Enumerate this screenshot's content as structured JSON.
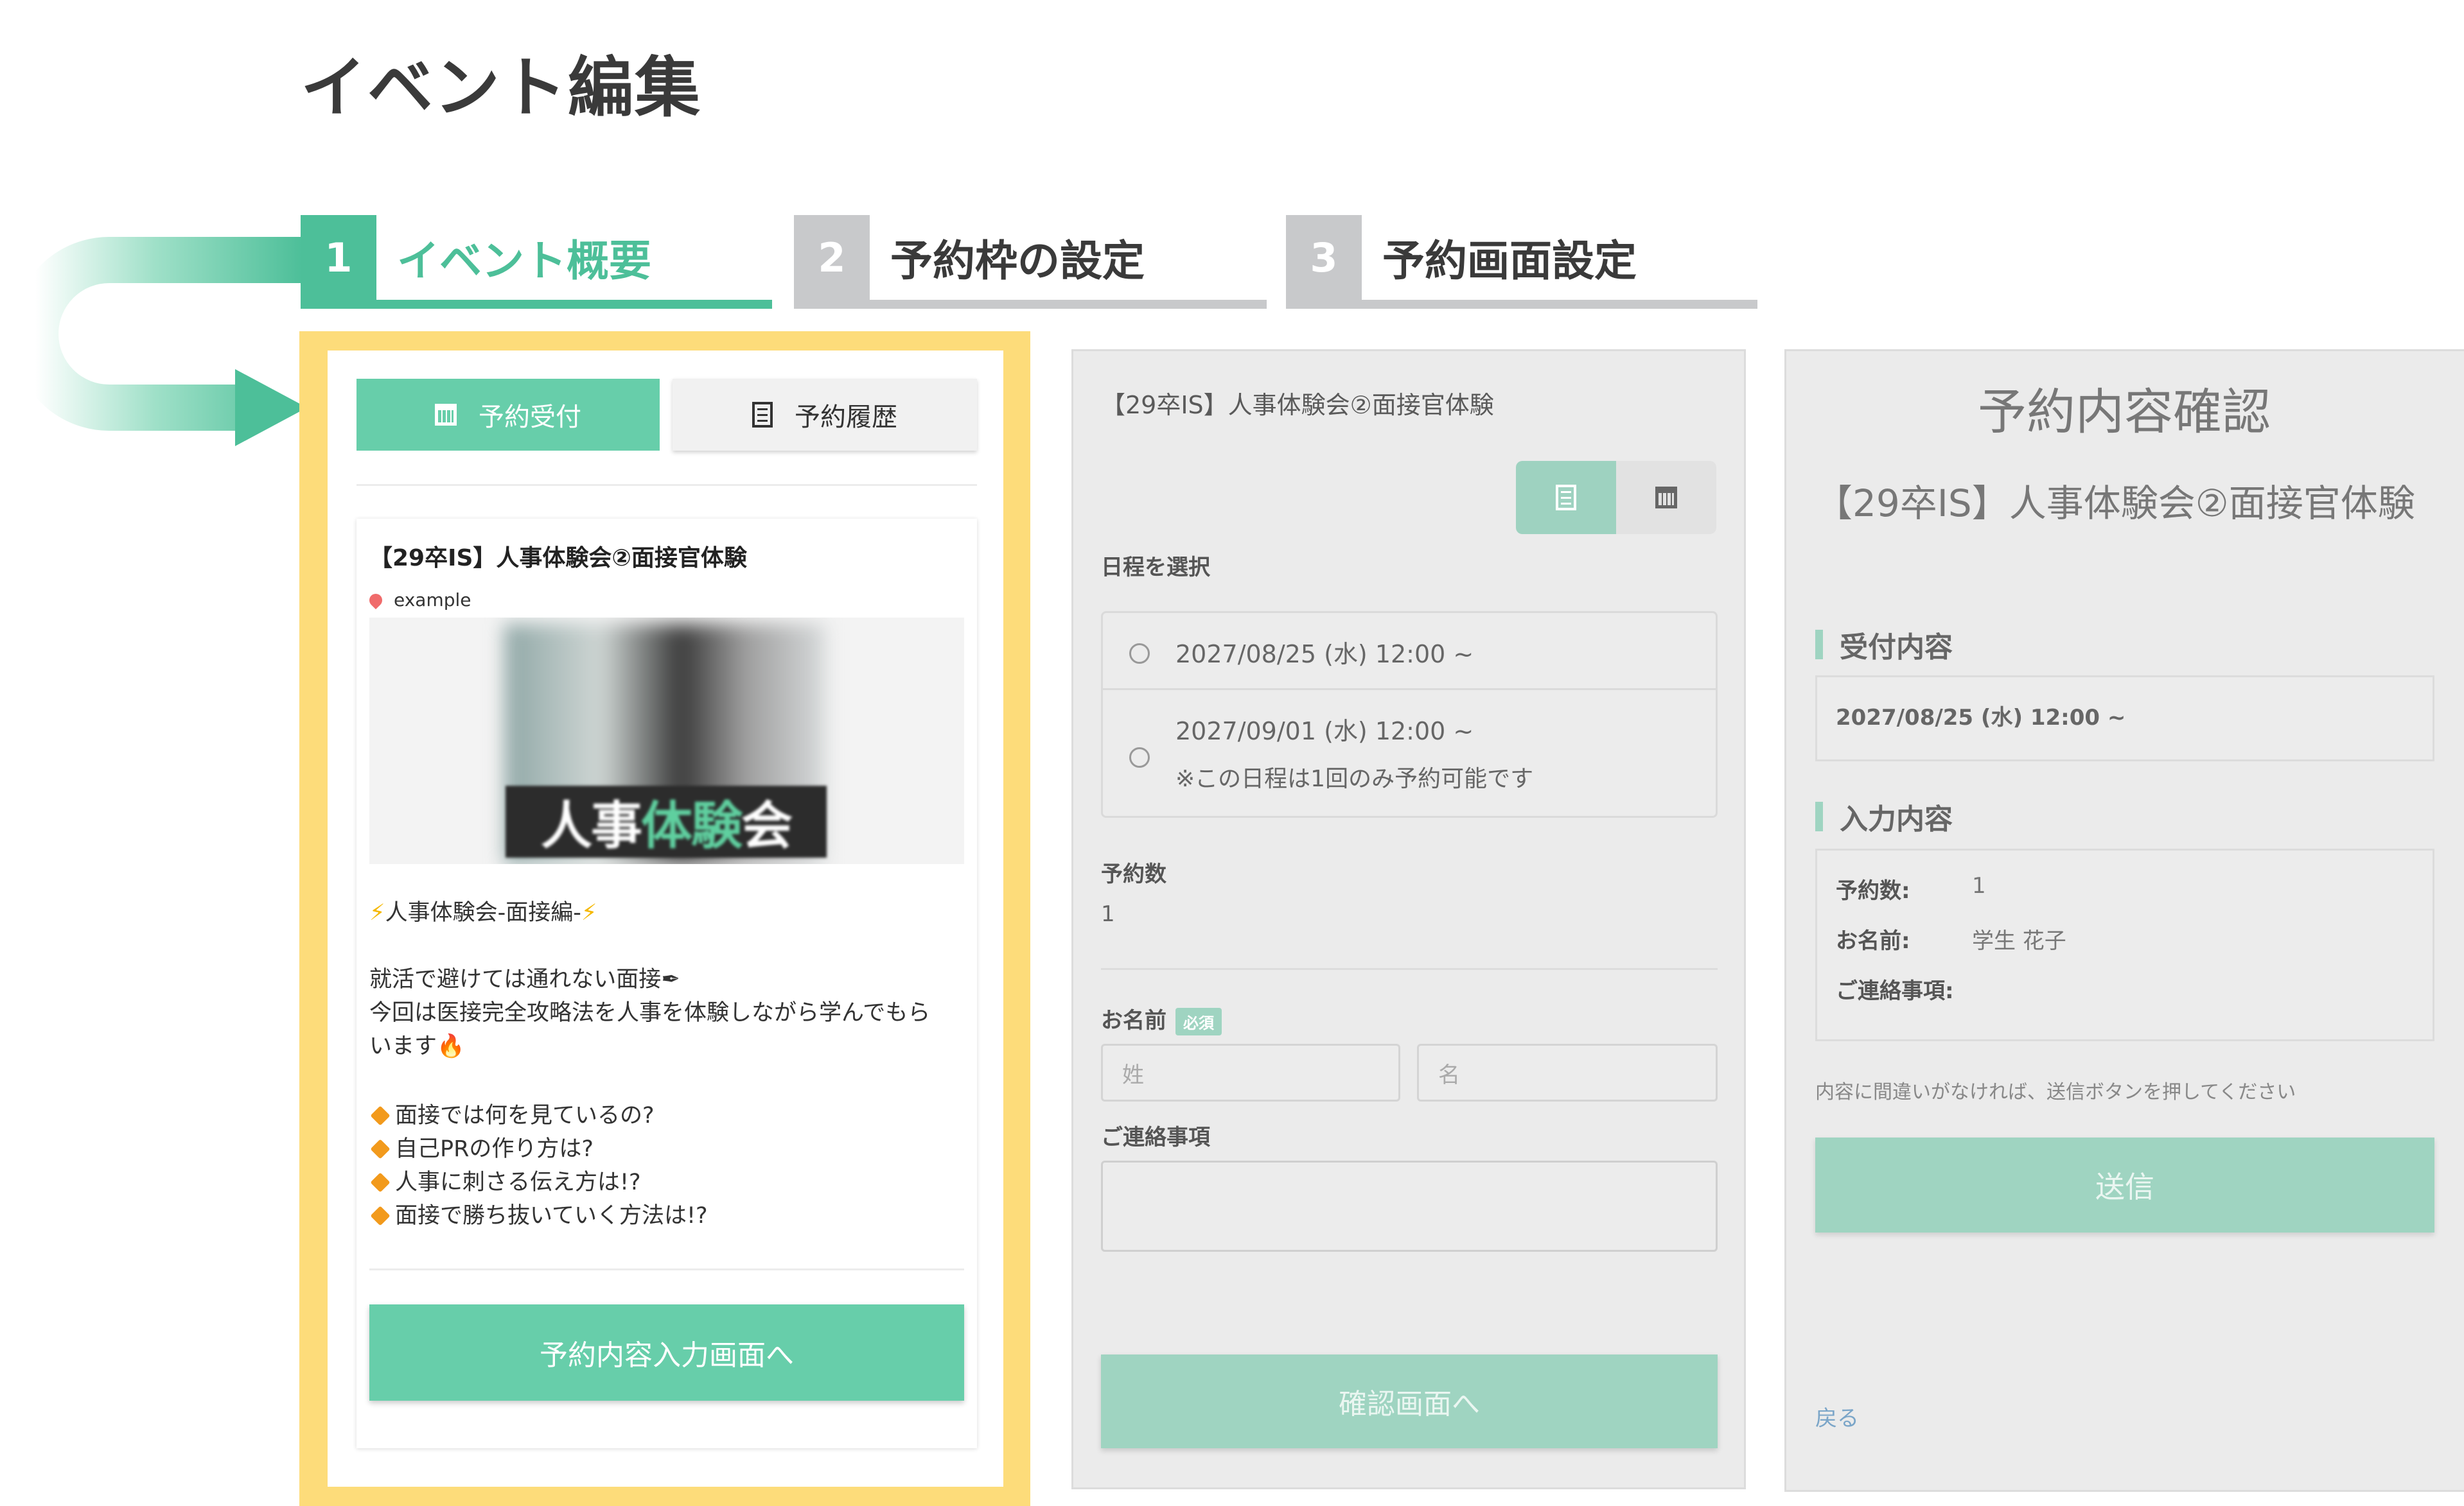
{
  "page_title": "イベント編集",
  "steps": [
    {
      "num": "1",
      "label": "イベント概要"
    },
    {
      "num": "2",
      "label": "予約枠の設定"
    },
    {
      "num": "3",
      "label": "予約画面設定"
    }
  ],
  "colors": {
    "accent": "#67ceaa",
    "accent_text": "#4dbf99",
    "inactive_step": "#c8c9cb",
    "highlight": "#fddc7a"
  },
  "panel1": {
    "tab_reserve": "予約受付",
    "tab_history": "予約履歴",
    "event_title": "【29卒IS】人事体験会②面接官体験",
    "location": "example",
    "image_banner": "人事体験会",
    "desc_heading": "人事体験会-面接編-",
    "desc_line1": "就活で避けては通れない面接",
    "desc_line2": "今回は医接完全攻略法を人事を体験しながら学んでもら",
    "desc_line3": "います",
    "bullets": [
      "面接では何を見ているの?",
      "自己PRの作り方は?",
      "人事に刺さる伝え方は!?",
      "面接で勝ち抜いていく方法は!?"
    ],
    "cta": "予約内容入力画面へ"
  },
  "panel2": {
    "event_title": "【29卒IS】人事体験会②面接官体験",
    "select_schedule": "日程を選択",
    "option1": "2027/08/25 (水) 12:00 ~",
    "option2": "2027/09/01 (水) 12:00 ~",
    "option2_note": "※この日程は1回のみ予約可能です",
    "count_label": "予約数",
    "count_value": "1",
    "name_label": "お名前",
    "required": "必須",
    "last_name_placeholder": "姓",
    "first_name_placeholder": "名",
    "contact_label": "ご連絡事項",
    "confirm_button": "確認画面へ"
  },
  "panel3": {
    "heading": "予約内容確認",
    "event_title": "【29卒IS】人事体験会②面接官体験",
    "reception_label": "受付内容",
    "reception_value": "2027/08/25 (水) 12:00 ~",
    "input_label": "入力内容",
    "count_key": "予約数:",
    "count_value": "1",
    "name_key": "お名前:",
    "name_value": "学生 花子",
    "contact_key": "ご連絡事項:",
    "note": "内容に間違いがなければ、送信ボタンを押してください",
    "send_button": "送信",
    "back_link": "戻る"
  }
}
